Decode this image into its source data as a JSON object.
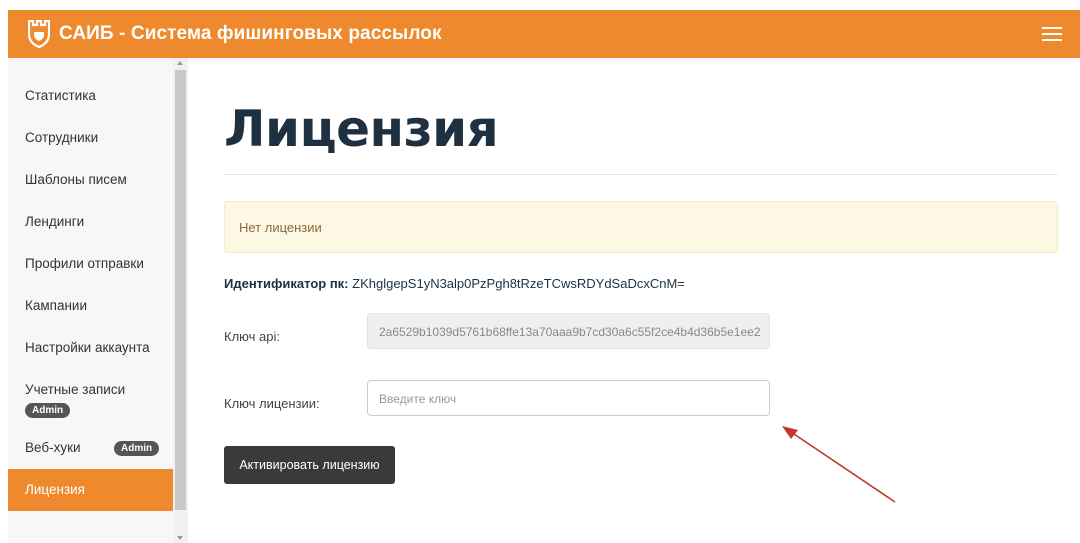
{
  "header": {
    "brand": "САИБ - Система фишинговых рассылок",
    "logo_icon": "castle-shield-icon",
    "menu_icon": "hamburger-menu-icon",
    "color": "#ee8a2d"
  },
  "sidebar": {
    "items": [
      {
        "label": "Статистика"
      },
      {
        "label": "Сотрудники"
      },
      {
        "label": "Шаблоны писем"
      },
      {
        "label": "Лендинги"
      },
      {
        "label": "Профили отправки"
      },
      {
        "label": "Кампании"
      },
      {
        "label": "Настройки аккаунта"
      },
      {
        "label": "Учетные записи",
        "badge": "Admin"
      },
      {
        "label": "Веб-хуки",
        "badge": "Admin"
      },
      {
        "label": "Лицензия",
        "active": true
      }
    ]
  },
  "main": {
    "title": "Лицензия",
    "alert": "Нет лицензии",
    "pc_id": {
      "label": "Идентификатор пк:",
      "value": "ZKhglgepS1yN3alp0PzPgh8tRzeTCwsRDYdSaDcxCnM="
    },
    "api_key": {
      "label": "Ключ api:",
      "value": "2a6529b1039d5761b68ffe13a70aaa9b7cd30a6c55f2ce4b4d36b5e1ee2"
    },
    "license_key": {
      "label": "Ключ лицензии:",
      "placeholder": "Введите ключ",
      "value": ""
    },
    "activate_button": "Активировать лицензию"
  },
  "annotation": {
    "icon": "red-arrow-icon",
    "color": "#c0392b"
  }
}
